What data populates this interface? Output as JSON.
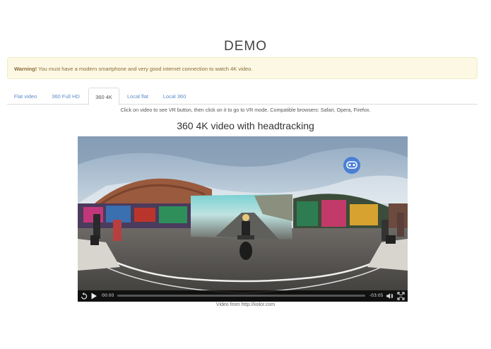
{
  "page": {
    "title": "DEMO"
  },
  "warning": {
    "strong": "Warning!",
    "text": " You must have a modern smartphone and very good internet connection to watch 4K video."
  },
  "tabs": [
    {
      "label": "Flat video",
      "active": false
    },
    {
      "label": "360 Full HD",
      "active": false
    },
    {
      "label": "360 4K",
      "active": true
    },
    {
      "label": "Local flat",
      "active": false
    },
    {
      "label": "Local 360",
      "active": false
    }
  ],
  "instructions": "Click on video to see VR button, then click on it to go to VR mode. Compatible browsers: Safari, Opera, Firefox.",
  "video": {
    "heading": "360 4K video with headtracking",
    "current_time": "00:00",
    "remaining_time": "-03:05",
    "progress": 0.0,
    "icons": [
      "vr-goggles-icon",
      "replay-icon",
      "play-icon",
      "volume-icon",
      "fullscreen-icon"
    ]
  },
  "credit": "Video from http://kolor.com",
  "colors": {
    "accent": "#5b8bc7",
    "warning_bg": "#fcf8e3",
    "vr_button": "#4a7fd4"
  }
}
